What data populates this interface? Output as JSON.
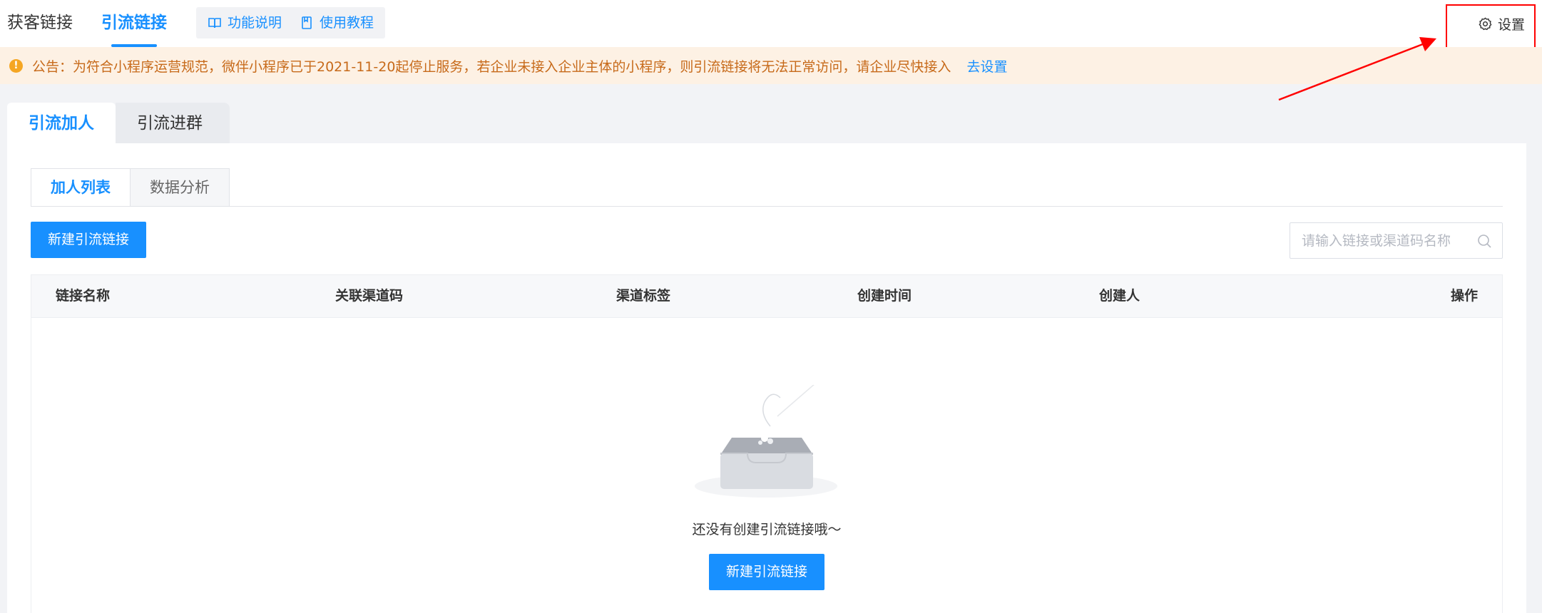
{
  "top_nav": {
    "tabs": [
      {
        "label": "获客链接",
        "active": false
      },
      {
        "label": "引流链接",
        "active": true
      }
    ],
    "links": [
      {
        "label": "功能说明",
        "icon": "book-icon"
      },
      {
        "label": "使用教程",
        "icon": "document-icon"
      }
    ],
    "settings_label": "设置"
  },
  "notice": {
    "text": "公告：为符合小程序运营规范，微伴小程序已于2021-11-20起停止服务，若企业未接入企业主体的小程序，则引流链接将无法正常访问，请企业尽快接入",
    "link_label": "去设置",
    "icon": "!"
  },
  "main_tabs": [
    {
      "label": "引流加人",
      "active": true
    },
    {
      "label": "引流进群",
      "active": false
    }
  ],
  "sub_tabs": [
    {
      "label": "加人列表",
      "active": true
    },
    {
      "label": "数据分析",
      "active": false
    }
  ],
  "toolbar": {
    "new_button_label": "新建引流链接",
    "search_placeholder": "请输入链接或渠道码名称"
  },
  "table": {
    "columns": [
      "链接名称",
      "关联渠道码",
      "渠道标签",
      "创建时间",
      "创建人",
      "操作"
    ],
    "rows": []
  },
  "empty_state": {
    "message": "还没有创建引流链接哦～",
    "button_label": "新建引流链接"
  },
  "colors": {
    "accent": "#1890ff",
    "notice_bg": "#fdf1e4",
    "notice_text": "#c76a1a",
    "highlight": "#ff0000"
  }
}
